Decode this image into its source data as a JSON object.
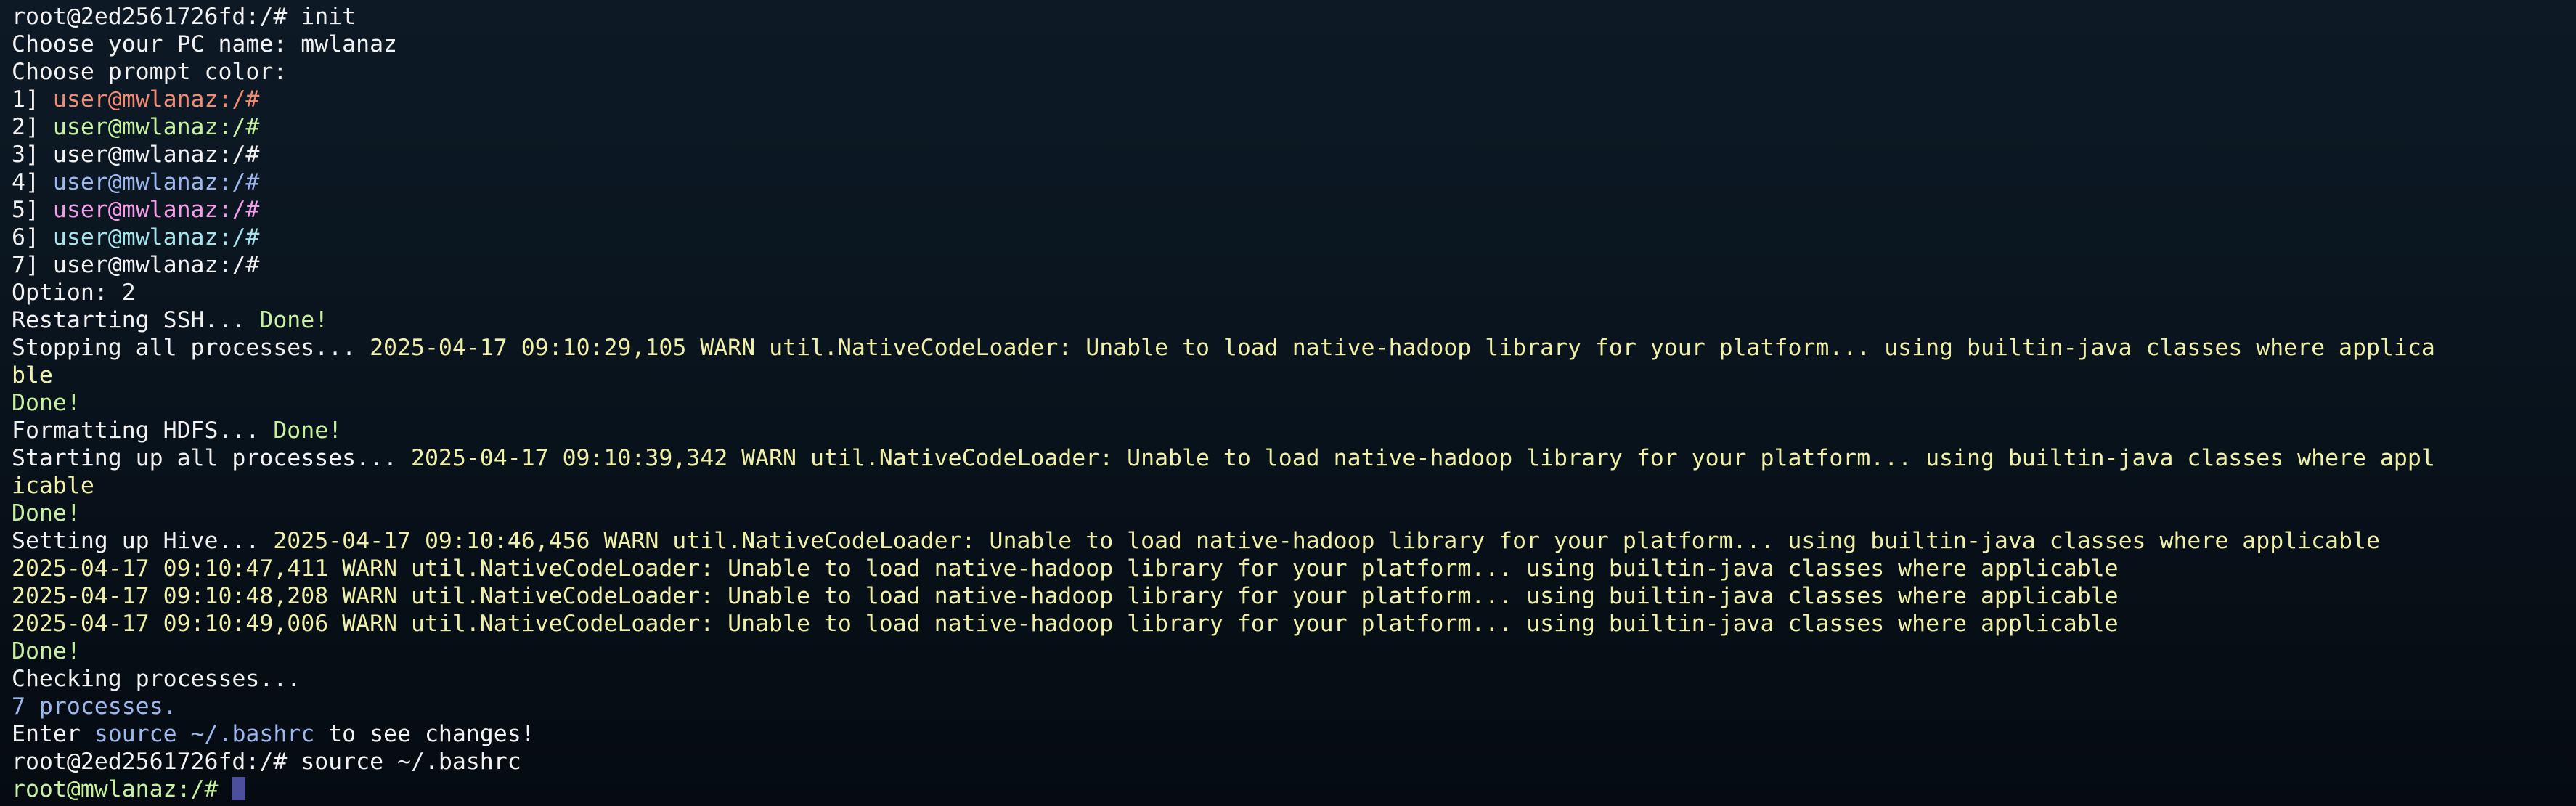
{
  "colors": {
    "default": "#f2f2f2",
    "yellow": "#f0f0a8",
    "green": "#c7f0a0",
    "red": "#f28b74",
    "blue": "#9db8ef",
    "magenta": "#f29ee8",
    "cyan": "#a6e3ec",
    "cursor": "#4b4f9c"
  },
  "terminal": {
    "lines": [
      {
        "segments": [
          {
            "text": "root@2ed2561726fd:/# init",
            "color": "default"
          }
        ]
      },
      {
        "segments": [
          {
            "text": "Choose your PC name: mwlanaz",
            "color": "default"
          }
        ]
      },
      {
        "segments": [
          {
            "text": "Choose prompt color:",
            "color": "default"
          }
        ]
      },
      {
        "segments": [
          {
            "text": "1] ",
            "color": "default"
          },
          {
            "text": "user@mwlanaz:/#",
            "color": "red"
          }
        ]
      },
      {
        "segments": [
          {
            "text": "2] ",
            "color": "default"
          },
          {
            "text": "user@mwlanaz:/#",
            "color": "green"
          }
        ]
      },
      {
        "segments": [
          {
            "text": "3] ",
            "color": "default"
          },
          {
            "text": "user@mwlanaz:/#",
            "color": "default"
          }
        ]
      },
      {
        "segments": [
          {
            "text": "4] ",
            "color": "default"
          },
          {
            "text": "user@mwlanaz:/#",
            "color": "blue"
          }
        ]
      },
      {
        "segments": [
          {
            "text": "5] ",
            "color": "default"
          },
          {
            "text": "user@mwlanaz:/#",
            "color": "magenta"
          }
        ]
      },
      {
        "segments": [
          {
            "text": "6] ",
            "color": "default"
          },
          {
            "text": "user@mwlanaz:/#",
            "color": "cyan"
          }
        ]
      },
      {
        "segments": [
          {
            "text": "7] ",
            "color": "default"
          },
          {
            "text": "user@mwlanaz:/#",
            "color": "default"
          }
        ]
      },
      {
        "segments": [
          {
            "text": "Option: 2",
            "color": "default"
          }
        ]
      },
      {
        "segments": [
          {
            "text": "Restarting SSH... ",
            "color": "default"
          },
          {
            "text": "Done!",
            "color": "green"
          }
        ]
      },
      {
        "segments": [
          {
            "text": "Stopping all processes... ",
            "color": "default"
          },
          {
            "text": "2025-04-17 09:10:29,105 WARN util.NativeCodeLoader: Unable to load native-hadoop library for your platform... using builtin-java classes where applica",
            "color": "yellow"
          }
        ]
      },
      {
        "segments": [
          {
            "text": "ble",
            "color": "yellow"
          }
        ]
      },
      {
        "segments": [
          {
            "text": "Done!",
            "color": "green"
          }
        ]
      },
      {
        "segments": [
          {
            "text": "Formatting HDFS... ",
            "color": "default"
          },
          {
            "text": "Done!",
            "color": "green"
          }
        ]
      },
      {
        "segments": [
          {
            "text": "Starting up all processes... ",
            "color": "default"
          },
          {
            "text": "2025-04-17 09:10:39,342 WARN util.NativeCodeLoader: Unable to load native-hadoop library for your platform... using builtin-java classes where appl",
            "color": "yellow"
          }
        ]
      },
      {
        "segments": [
          {
            "text": "icable",
            "color": "yellow"
          }
        ]
      },
      {
        "segments": [
          {
            "text": "Done!",
            "color": "green"
          }
        ]
      },
      {
        "segments": [
          {
            "text": "Setting up Hive... ",
            "color": "default"
          },
          {
            "text": "2025-04-17 09:10:46,456 WARN util.NativeCodeLoader: Unable to load native-hadoop library for your platform... using builtin-java classes where applicable",
            "color": "yellow"
          }
        ]
      },
      {
        "segments": [
          {
            "text": "2025-04-17 09:10:47,411 WARN util.NativeCodeLoader: Unable to load native-hadoop library for your platform... using builtin-java classes where applicable",
            "color": "yellow"
          }
        ]
      },
      {
        "segments": [
          {
            "text": "2025-04-17 09:10:48,208 WARN util.NativeCodeLoader: Unable to load native-hadoop library for your platform... using builtin-java classes where applicable",
            "color": "yellow"
          }
        ]
      },
      {
        "segments": [
          {
            "text": "2025-04-17 09:10:49,006 WARN util.NativeCodeLoader: Unable to load native-hadoop library for your platform... using builtin-java classes where applicable",
            "color": "yellow"
          }
        ]
      },
      {
        "segments": [
          {
            "text": "Done!",
            "color": "green"
          }
        ]
      },
      {
        "segments": [
          {
            "text": "Checking processes...",
            "color": "default"
          }
        ]
      },
      {
        "segments": [
          {
            "text": "7 processes.",
            "color": "blue"
          }
        ]
      },
      {
        "segments": [
          {
            "text": "Enter ",
            "color": "default"
          },
          {
            "text": "source ~/.bashrc",
            "color": "blue"
          },
          {
            "text": " to see changes!",
            "color": "default"
          }
        ]
      },
      {
        "segments": [
          {
            "text": "root@2ed2561726fd:/# source ~/.bashrc",
            "color": "default"
          }
        ]
      },
      {
        "segments": [
          {
            "text": "root@mwlanaz:/# ",
            "color": "green"
          }
        ],
        "cursor": true
      }
    ]
  }
}
